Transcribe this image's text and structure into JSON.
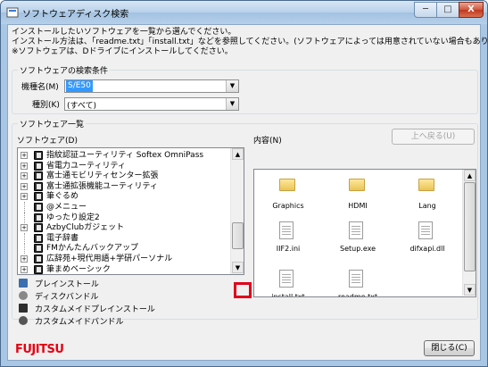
{
  "window": {
    "title": "ソフトウェアディスク検索",
    "min_label": "─",
    "max_label": "□",
    "close_label": "X"
  },
  "intro": {
    "line1": "インストールしたいソフトウェアを一覧から選んでください。",
    "line2": "インストール方法は、「readme.txt」「install.txt」などを参照してください。(ソフトウェアによっては用意されていない場合もあります)",
    "line3": "※ソフトウェアは、Dドライブにインストールしてください。"
  },
  "search": {
    "group_label": "ソフトウェアの検索条件",
    "model_label": "機種名(M)",
    "model_value": "S/E50",
    "type_label": "種別(K)",
    "type_value": "(すべて)"
  },
  "software": {
    "group_label": "ソフトウェア一覧",
    "tree_label": "ソフトウェア(D)",
    "content_label": "内容(N)",
    "up_button": "上へ戻る(U)",
    "items": [
      {
        "label": "指紋認証ユーティリティ Softex OmniPass",
        "expand": true
      },
      {
        "label": "省電力ユーティリティ",
        "expand": true
      },
      {
        "label": "富士通モビリティセンター拡張",
        "expand": true
      },
      {
        "label": "富士通拡張機能ユーティリティ",
        "expand": true
      },
      {
        "label": "筆ぐるめ",
        "expand": true
      },
      {
        "label": "@メニュー",
        "expand": false
      },
      {
        "label": "ゆったり設定2",
        "expand": false
      },
      {
        "label": "AzbyClubガジェット",
        "expand": true
      },
      {
        "label": "電子辞書",
        "expand": false
      },
      {
        "label": "FMかんたんバックアップ",
        "expand": false
      },
      {
        "label": "広辞苑+現代用語+学研パーソナル",
        "expand": true
      },
      {
        "label": "筆まめベーシック",
        "expand": true
      }
    ],
    "files": [
      {
        "name": "Graphics",
        "icon": "folder-icon"
      },
      {
        "name": "HDMI",
        "icon": "folder-icon"
      },
      {
        "name": "Lang",
        "icon": "folder-icon"
      },
      {
        "name": "IIF2.ini",
        "icon": "settings-file-icon"
      },
      {
        "name": "Setup.exe",
        "icon": "setup-icon"
      },
      {
        "name": "difxapi.dll",
        "icon": "dll-file-icon"
      },
      {
        "name": "install.txt",
        "icon": "text-file-icon"
      },
      {
        "name": "readme.txt",
        "icon": "text-file-icon"
      }
    ]
  },
  "legend": [
    {
      "label": "プレインストール",
      "icon": "preinstall-icon"
    },
    {
      "label": "ディスクバンドル",
      "icon": "disc-bundle-icon"
    },
    {
      "label": "カスタムメイドプレインストール",
      "icon": "custom-preinstall-icon"
    },
    {
      "label": "カスタムメイドバンドル",
      "icon": "custom-bundle-icon"
    }
  ],
  "footer": {
    "logo": "FUJITSU",
    "close_button": "閉じる(C)"
  },
  "colors": {
    "logo": "#e60012",
    "highlight": "#e0001b",
    "selection": "#3399ff"
  }
}
